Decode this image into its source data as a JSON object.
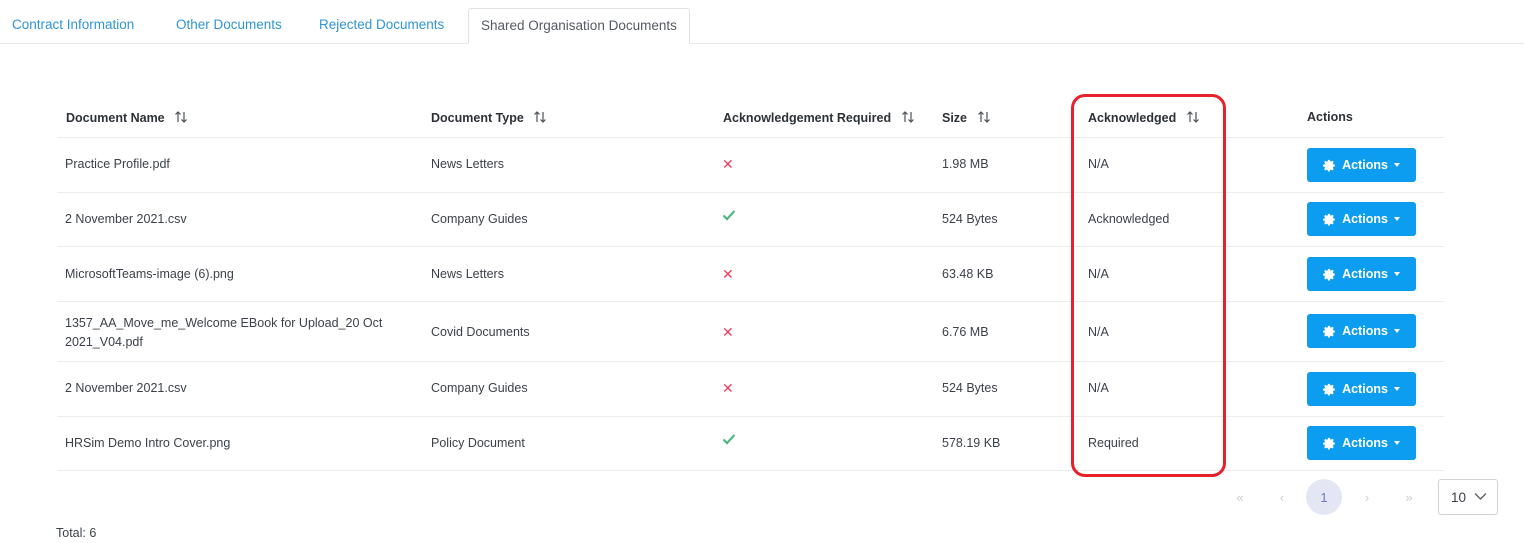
{
  "tabs": [
    {
      "label": "Contract Information"
    },
    {
      "label": "Other Documents"
    },
    {
      "label": "Rejected Documents"
    },
    {
      "label": "Shared Organisation Documents"
    }
  ],
  "table": {
    "headers": {
      "document_name": "Document Name",
      "document_type": "Document Type",
      "ack_required": "Acknowledgement Required",
      "size": "Size",
      "acknowledged": "Acknowledged",
      "actions": "Actions"
    },
    "rows": [
      {
        "name": "Practice Profile.pdf",
        "type": "News Letters",
        "ack_required": "no",
        "size": "1.98 MB",
        "acknowledged": "N/A",
        "action": "Actions"
      },
      {
        "name": "2 November 2021.csv",
        "type": "Company Guides",
        "ack_required": "yes",
        "size": "524 Bytes",
        "acknowledged": "Acknowledged",
        "action": "Actions"
      },
      {
        "name": "MicrosoftTeams-image (6).png",
        "type": "News Letters",
        "ack_required": "no",
        "size": "63.48 KB",
        "acknowledged": "N/A",
        "action": "Actions"
      },
      {
        "name_line1": "1357_AA_Move_me_Welcome EBook for Upload_20 Oct",
        "name_line2": "2021_V04.pdf",
        "type": "Covid Documents",
        "ack_required": "no",
        "size": "6.76 MB",
        "acknowledged": "N/A",
        "action": "Actions"
      },
      {
        "name": "2 November 2021.csv",
        "type": "Company Guides",
        "ack_required": "no",
        "size": "524 Bytes",
        "acknowledged": "N/A",
        "action": "Actions"
      },
      {
        "name": "HRSim Demo Intro Cover.png",
        "type": "Policy Document",
        "ack_required": "yes",
        "size": "578.19 KB",
        "acknowledged": "Required",
        "action": "Actions"
      }
    ]
  },
  "icons": {
    "ack_no": "x-icon",
    "ack_yes": "check-icon",
    "sort": "sort-icon",
    "gear": "gear-icon"
  },
  "colors": {
    "tab_link": "#2f95d6",
    "button": "#0d9df0",
    "x_mark": "#e5405e",
    "check_mark": "#4cb781",
    "highlight": "#e8202a"
  },
  "pagination": {
    "first": "«",
    "prev": "‹",
    "current": "1",
    "next": "›",
    "last": "»",
    "page_size": "10"
  },
  "total_label": "Total: 6"
}
